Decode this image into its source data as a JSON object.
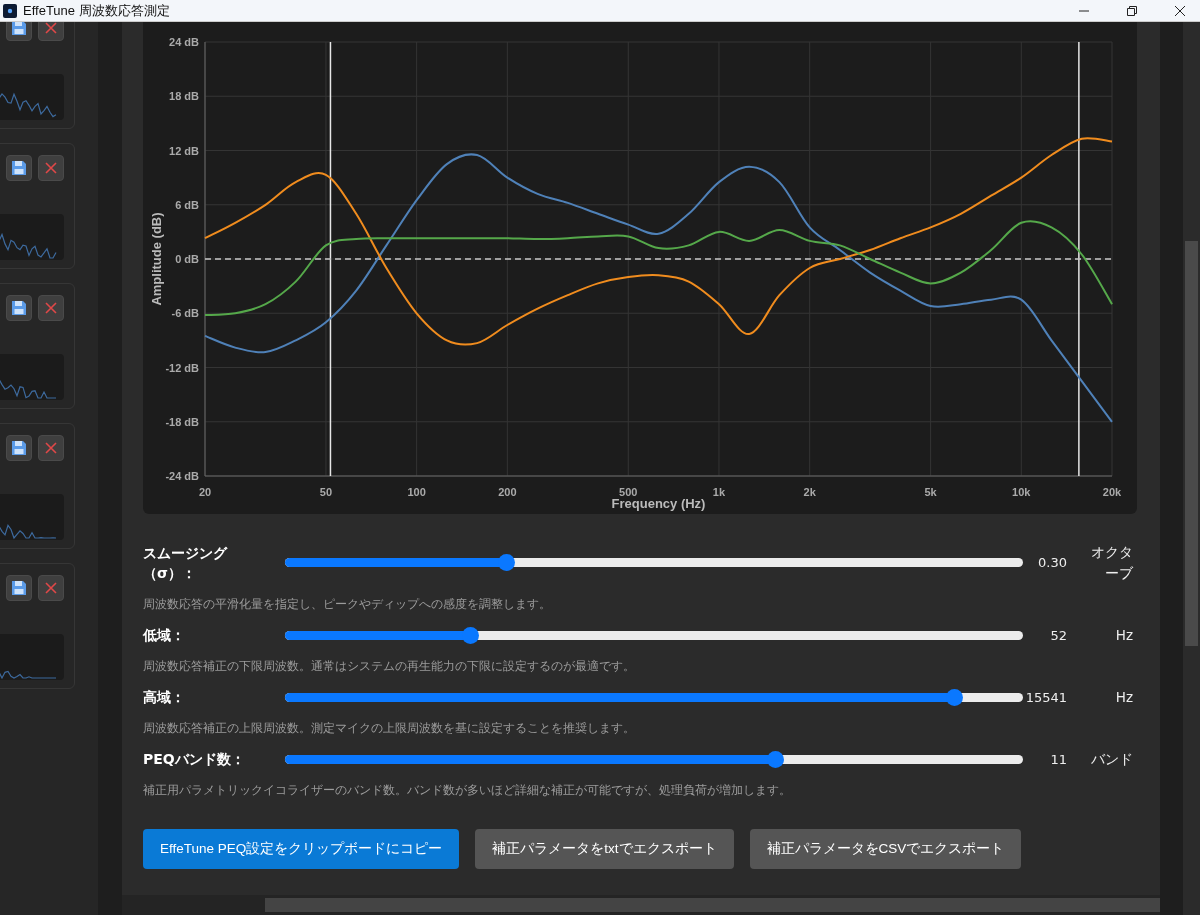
{
  "window": {
    "title": "EffeTune 周波数応答測定"
  },
  "chart": {
    "chart_data": {
      "type": "line",
      "grid": true,
      "ref_lines": [
        {
          "axis": "y",
          "value": 0
        }
      ],
      "xlabel": "Frequency (Hz)",
      "ylabel": "Amplitude (dB)",
      "ylim": [
        -24,
        24
      ],
      "categories": [
        "20",
        null,
        null,
        null,
        "50",
        null,
        null,
        "100",
        null,
        null,
        "200",
        null,
        null,
        null,
        "500",
        null,
        null,
        "1k",
        null,
        null,
        "2k",
        null,
        null,
        null,
        "5k",
        null,
        null,
        "10k",
        null,
        null,
        "20k"
      ],
      "series": [
        {
          "color": "#4f81b8",
          "values": [
            -8.5,
            -9.8,
            -10.3,
            -9,
            -7,
            -3.5,
            1.5,
            6.5,
            10.5,
            11.5,
            9,
            7.2,
            6.2,
            5,
            3.8,
            2.8,
            5,
            8.5,
            10.2,
            8.5,
            3.5,
            1,
            -1.5,
            -3.5,
            -5.2,
            -5,
            -4.5,
            -4.5,
            -9,
            -13.5,
            -18
          ]
        },
        {
          "color": "#f08c1e",
          "values": [
            2.3,
            4,
            6,
            8.5,
            9.3,
            5,
            -1,
            -6,
            -9,
            -9.3,
            -7.3,
            -5.5,
            -4,
            -2.7,
            -2,
            -1.8,
            -2.5,
            -5,
            -8.3,
            -4,
            -1,
            0,
            1,
            2.3,
            3.5,
            5,
            7,
            9,
            11.5,
            13.3,
            13
          ]
        },
        {
          "color": "#55a84a",
          "values": [
            -6.2,
            -6,
            -5,
            -2.5,
            1.5,
            2.2,
            2.3,
            2.3,
            2.3,
            2.3,
            2.3,
            2.2,
            2.3,
            2.5,
            2.5,
            1.2,
            1.5,
            3,
            2,
            3.2,
            2,
            1.5,
            0,
            -1.5,
            -2.7,
            -1.5,
            1,
            4,
            3.5,
            0.5,
            -5
          ]
        }
      ],
      "yticks": [
        {
          "value": -24,
          "label": "-24 dB"
        },
        {
          "value": -18,
          "label": "-18 dB"
        },
        {
          "value": -12,
          "label": "-12 dB"
        },
        {
          "value": -6,
          "label": "-6 dB"
        },
        {
          "value": 0,
          "label": "0 dB"
        },
        {
          "value": 6,
          "label": "6 dB"
        },
        {
          "value": 12,
          "label": "12 dB"
        },
        {
          "value": 18,
          "label": "18 dB"
        },
        {
          "value": 24,
          "label": "24 dB"
        }
      ]
    }
  },
  "settings": [
    {
      "label": "スムージング（σ）：",
      "level": 0.3,
      "value": "0.30",
      "unit": "オクターブ",
      "description": "周波数応答の平滑化量を指定し、ピークやディップへの感度を調整します。"
    },
    {
      "label": "低域：",
      "level": 0.25,
      "value": "52",
      "unit": "Hz",
      "description": "周波数応答補正の下限周波数。通常はシステムの再生能力の下限に設定するのが最適です。"
    },
    {
      "label": "高域：",
      "level": 0.906,
      "value": "15541",
      "unit": "Hz",
      "description": "周波数応答補正の上限周波数。測定マイクの上限周波数を基に設定することを推奨します。"
    },
    {
      "label": "PEQバンド数：",
      "level": 0.664,
      "value": "11",
      "unit": "バンド",
      "description": "補正用パラメトリックイコライザーのバンド数。バンド数が多いほど詳細な補正が可能ですが、処理負荷が増加します。"
    }
  ],
  "buttons": [
    {
      "label": "EffeTune PEQ設定をクリップボードにコピー",
      "primary": true
    },
    {
      "label": "補正パラメータをtxtでエクスポート",
      "primary": false
    },
    {
      "label": "補正パラメータをCSVでエクスポート",
      "primary": false
    }
  ]
}
